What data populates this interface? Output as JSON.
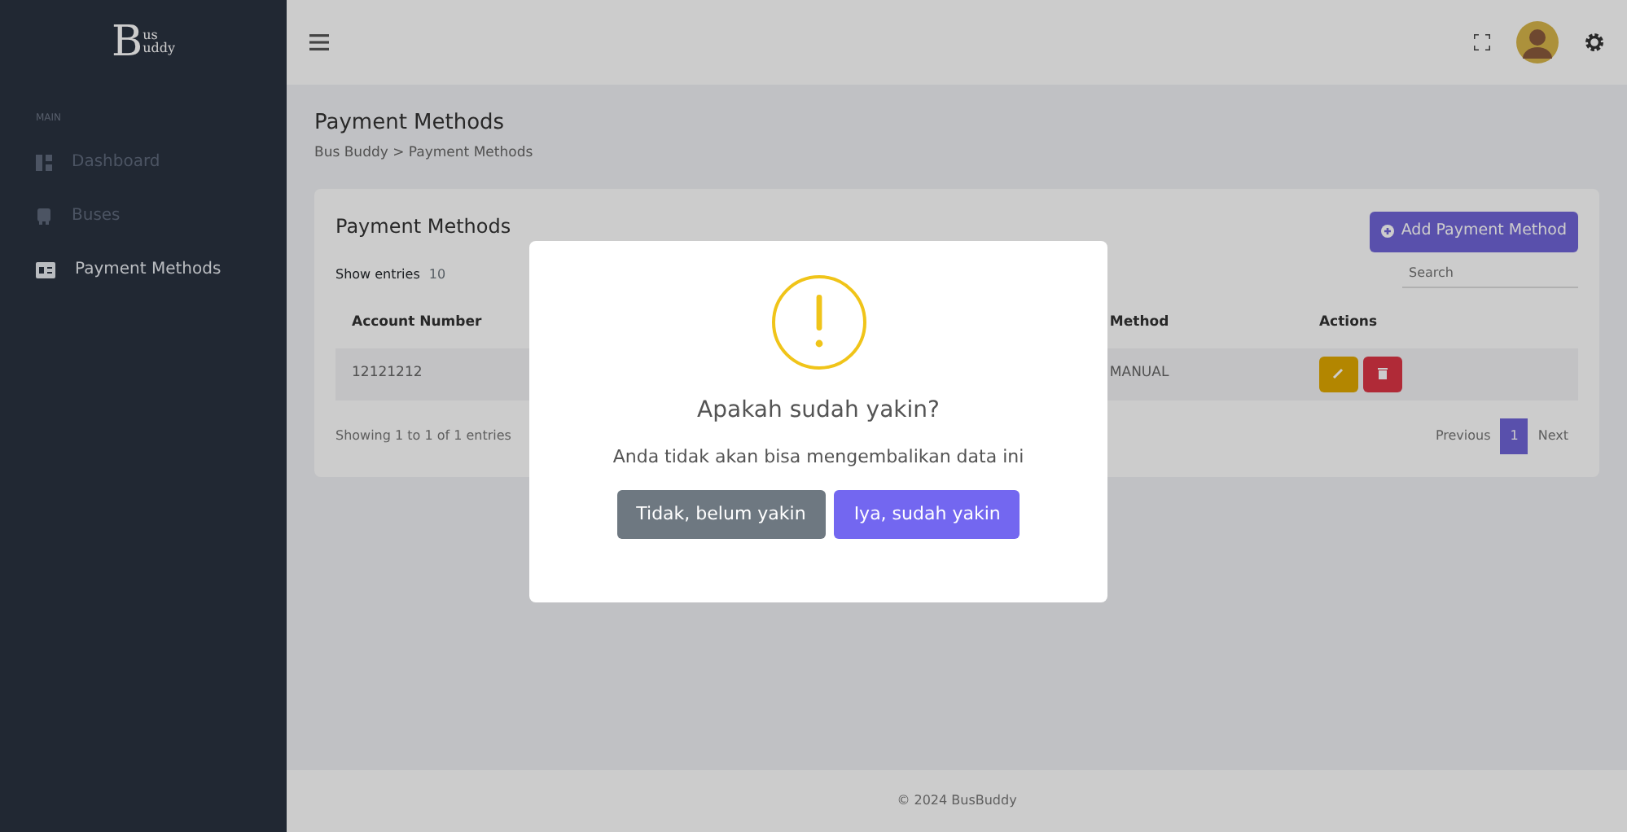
{
  "sidebar": {
    "logo": {
      "initial": "B",
      "line1": "us",
      "line2": "uddy"
    },
    "section": "MAIN",
    "items": [
      {
        "label": "Dashboard",
        "kind": "dashboard",
        "selected": false
      },
      {
        "label": "Buses",
        "kind": "bus",
        "selected": false
      },
      {
        "label": "Payment Methods",
        "kind": "card",
        "selected": true
      }
    ]
  },
  "page": {
    "title": "Payment Methods",
    "breadcrumb": [
      "Bus Buddy",
      ">",
      "Payment Methods"
    ]
  },
  "card": {
    "title": "Payment Methods",
    "add_button": "Add Payment Method",
    "show_entries": {
      "label": "Show entries",
      "value": "10"
    },
    "search": {
      "placeholder": "Search"
    },
    "table": {
      "columns": [
        "Account Number",
        "Method",
        "Actions"
      ],
      "rows": [
        {
          "account": "12121212",
          "method": "MANUAL"
        }
      ]
    },
    "info": "Showing 1 to 1 of 1 entries",
    "pagination": [
      {
        "label": "Previous",
        "selected": false
      },
      {
        "label": "1",
        "selected": true
      },
      {
        "label": "Next",
        "selected": false
      }
    ]
  },
  "footer": "© 2024 BusBuddy",
  "dialog": {
    "title": "Apakah sudah yakin?",
    "text": "Anda tidak akan bisa mengembalikan data ini",
    "buttons": [
      {
        "label": "Tidak, belum yakin",
        "kind": "cancel"
      },
      {
        "label": "Iya, sudah yakin",
        "kind": "confirm"
      }
    ]
  }
}
